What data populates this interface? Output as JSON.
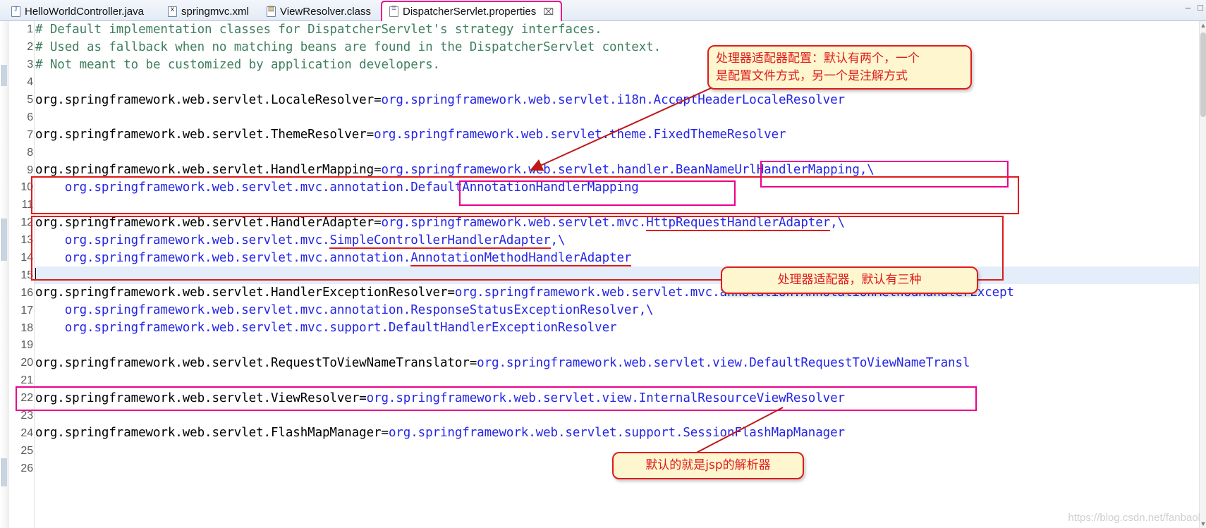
{
  "window": {
    "minimize_label": "–",
    "maximize_label": "□"
  },
  "tabs": [
    {
      "label": "HelloWorldController.java",
      "icon": "java-file-icon",
      "active": false,
      "close": ""
    },
    {
      "label": "springmvc.xml",
      "icon": "xml-file-icon",
      "active": false,
      "close": ""
    },
    {
      "label": "ViewResolver.class",
      "icon": "class-file-icon",
      "active": false,
      "close": ""
    },
    {
      "label": "DispatcherServlet.properties",
      "icon": "properties-file-icon",
      "active": true,
      "close": "⌧"
    }
  ],
  "editor": {
    "current_line": 15,
    "lines": [
      {
        "n": 1,
        "type": "comment",
        "text": "# Default implementation classes for DispatcherServlet's strategy interfaces."
      },
      {
        "n": 2,
        "type": "comment",
        "text": "# Used as fallback when no matching beans are found in the DispatcherServlet context."
      },
      {
        "n": 3,
        "type": "comment",
        "text": "# Not meant to be customized by application developers."
      },
      {
        "n": 4,
        "type": "blank",
        "text": ""
      },
      {
        "n": 5,
        "type": "prop",
        "key": "org.springframework.web.servlet.LocaleResolver",
        "value": "org.springframework.web.servlet.i18n.AcceptHeaderLocaleResolver"
      },
      {
        "n": 6,
        "type": "blank",
        "text": ""
      },
      {
        "n": 7,
        "type": "prop",
        "key": "org.springframework.web.servlet.ThemeResolver",
        "value": "org.springframework.web.servlet.theme.FixedThemeResolver"
      },
      {
        "n": 8,
        "type": "blank",
        "text": ""
      },
      {
        "n": 9,
        "type": "prop",
        "key": "org.springframework.web.servlet.HandlerMapping",
        "value": "org.springframework.web.servlet.handler.BeanNameUrlHandlerMapping,\\"
      },
      {
        "n": 10,
        "type": "cont",
        "value": "    org.springframework.web.servlet.mvc.annotation.DefaultAnnotationHandlerMapping"
      },
      {
        "n": 11,
        "type": "blank",
        "text": ""
      },
      {
        "n": 12,
        "type": "prop",
        "key": "org.springframework.web.servlet.HandlerAdapter",
        "value": "org.springframework.web.servlet.mvc.HttpRequestHandlerAdapter,\\"
      },
      {
        "n": 13,
        "type": "cont",
        "value": "    org.springframework.web.servlet.mvc.SimpleControllerHandlerAdapter,\\"
      },
      {
        "n": 14,
        "type": "cont",
        "value": "    org.springframework.web.servlet.mvc.annotation.AnnotationMethodHandlerAdapter"
      },
      {
        "n": 15,
        "type": "blank",
        "text": ""
      },
      {
        "n": 16,
        "type": "prop",
        "key": "org.springframework.web.servlet.HandlerExceptionResolver",
        "value": "org.springframework.web.servlet.mvc.annotation.AnnotationMethodHandlerExcept"
      },
      {
        "n": 17,
        "type": "cont",
        "value": "    org.springframework.web.servlet.mvc.annotation.ResponseStatusExceptionResolver,\\"
      },
      {
        "n": 18,
        "type": "cont",
        "value": "    org.springframework.web.servlet.mvc.support.DefaultHandlerExceptionResolver"
      },
      {
        "n": 19,
        "type": "blank",
        "text": ""
      },
      {
        "n": 20,
        "type": "prop",
        "key": "org.springframework.web.servlet.RequestToViewNameTranslator",
        "value": "org.springframework.web.servlet.view.DefaultRequestToViewNameTransl"
      },
      {
        "n": 21,
        "type": "blank",
        "text": ""
      },
      {
        "n": 22,
        "type": "prop",
        "key": "org.springframework.web.servlet.ViewResolver",
        "value": "org.springframework.web.servlet.view.InternalResourceViewResolver"
      },
      {
        "n": 23,
        "type": "blank",
        "text": ""
      },
      {
        "n": 24,
        "type": "prop",
        "key": "org.springframework.web.servlet.FlashMapManager",
        "value": "org.springframework.web.servlet.support.SessionFlashMapManager"
      },
      {
        "n": 25,
        "type": "blank",
        "text": ""
      },
      {
        "n": 26,
        "type": "blank",
        "text": ""
      }
    ]
  },
  "annotations": {
    "callout_handler_adapter_config": "处理器适配器配置：默认有两个，一个\n是配置文件方式，另一个是注解方式",
    "callout_handler_adapter_three": "处理器适配器，默认有三种",
    "callout_jsp_resolver": "默认的就是jsp的解析器"
  },
  "watermark": "https://blog.csdn.net/fanbaol",
  "colors": {
    "comment": "#3f7f5f",
    "value": "#2424e8",
    "key": "#000000",
    "annotation_red": "#e01b1b",
    "annotation_magenta": "#ec008c",
    "callout_bg": "#fdf6cf",
    "current_line_bg": "#e4eefb"
  }
}
